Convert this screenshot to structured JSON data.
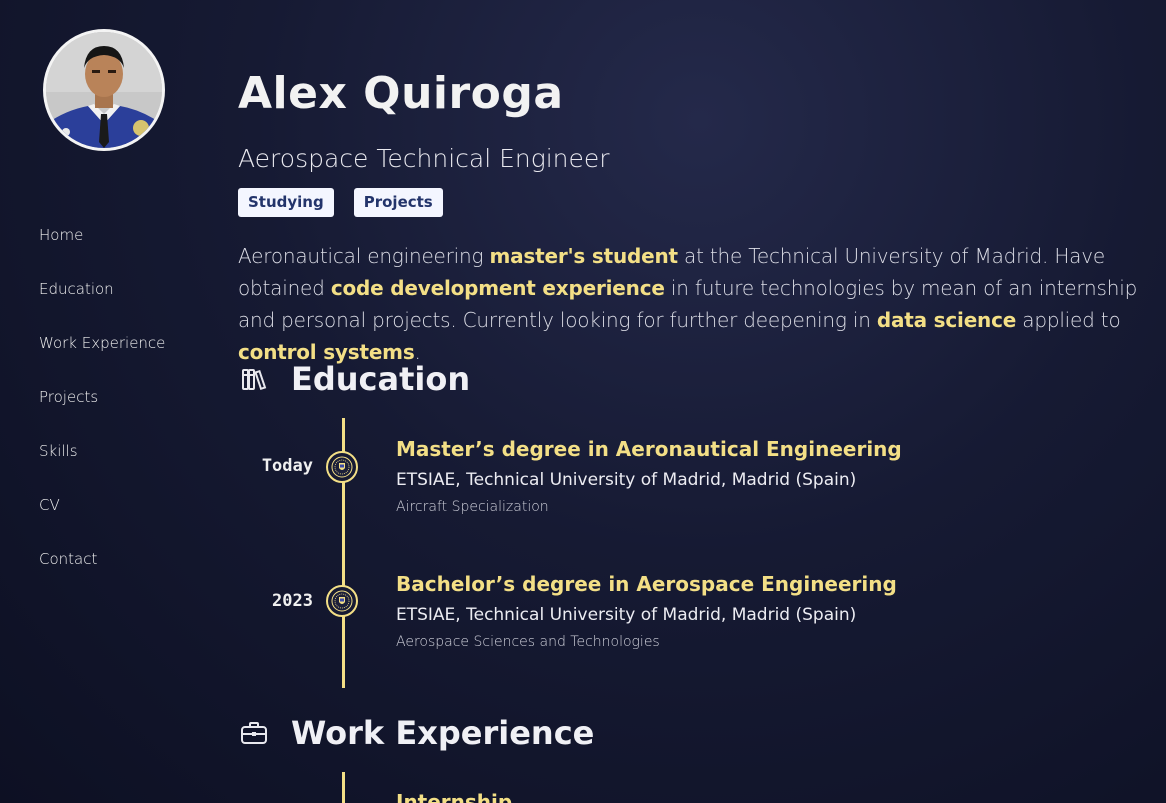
{
  "sidebar": {
    "nav": [
      "Home",
      "Education",
      "Work Experience",
      "Projects",
      "Skills",
      "CV",
      "Contact"
    ]
  },
  "hero": {
    "name": "Alex Quiroga",
    "subtitle": "Aerospace Technical Engineer",
    "tags": [
      "Studying",
      "Projects"
    ],
    "bio": [
      {
        "t": "Aeronautical engineering ",
        "h": false
      },
      {
        "t": "master's student",
        "h": true
      },
      {
        "t": " at the Technical University of Madrid. Have obtained ",
        "h": false
      },
      {
        "t": "code development experience",
        "h": true
      },
      {
        "t": " in future technologies by mean of an internship and personal projects. Currently looking for further deepening in ",
        "h": false
      },
      {
        "t": "data science",
        "h": true
      },
      {
        "t": " applied to ",
        "h": false
      },
      {
        "t": "control systems",
        "h": true
      },
      {
        "t": ".",
        "h": false
      }
    ]
  },
  "education": {
    "title": "Education",
    "icon": "books-icon",
    "items": [
      {
        "date": "Today",
        "title": "Master’s degree in Aeronautical Engineering",
        "place": "ETSIAE, Technical University of Madrid, Madrid (Spain)",
        "note": "Aircraft Specialization"
      },
      {
        "date": "2023",
        "title": "Bachelor’s degree in Aerospace Engineering",
        "place": "ETSIAE, Technical University of Madrid, Madrid (Spain)",
        "note": "Aerospace Sciences and Technologies"
      }
    ]
  },
  "work": {
    "title": "Work Experience",
    "icon": "briefcase-icon",
    "first_item_title": "Internship"
  },
  "colors": {
    "accent": "#f3df86",
    "background": "#161a33",
    "tag_bg": "#f4f6ff",
    "tag_text": "#23346b"
  }
}
